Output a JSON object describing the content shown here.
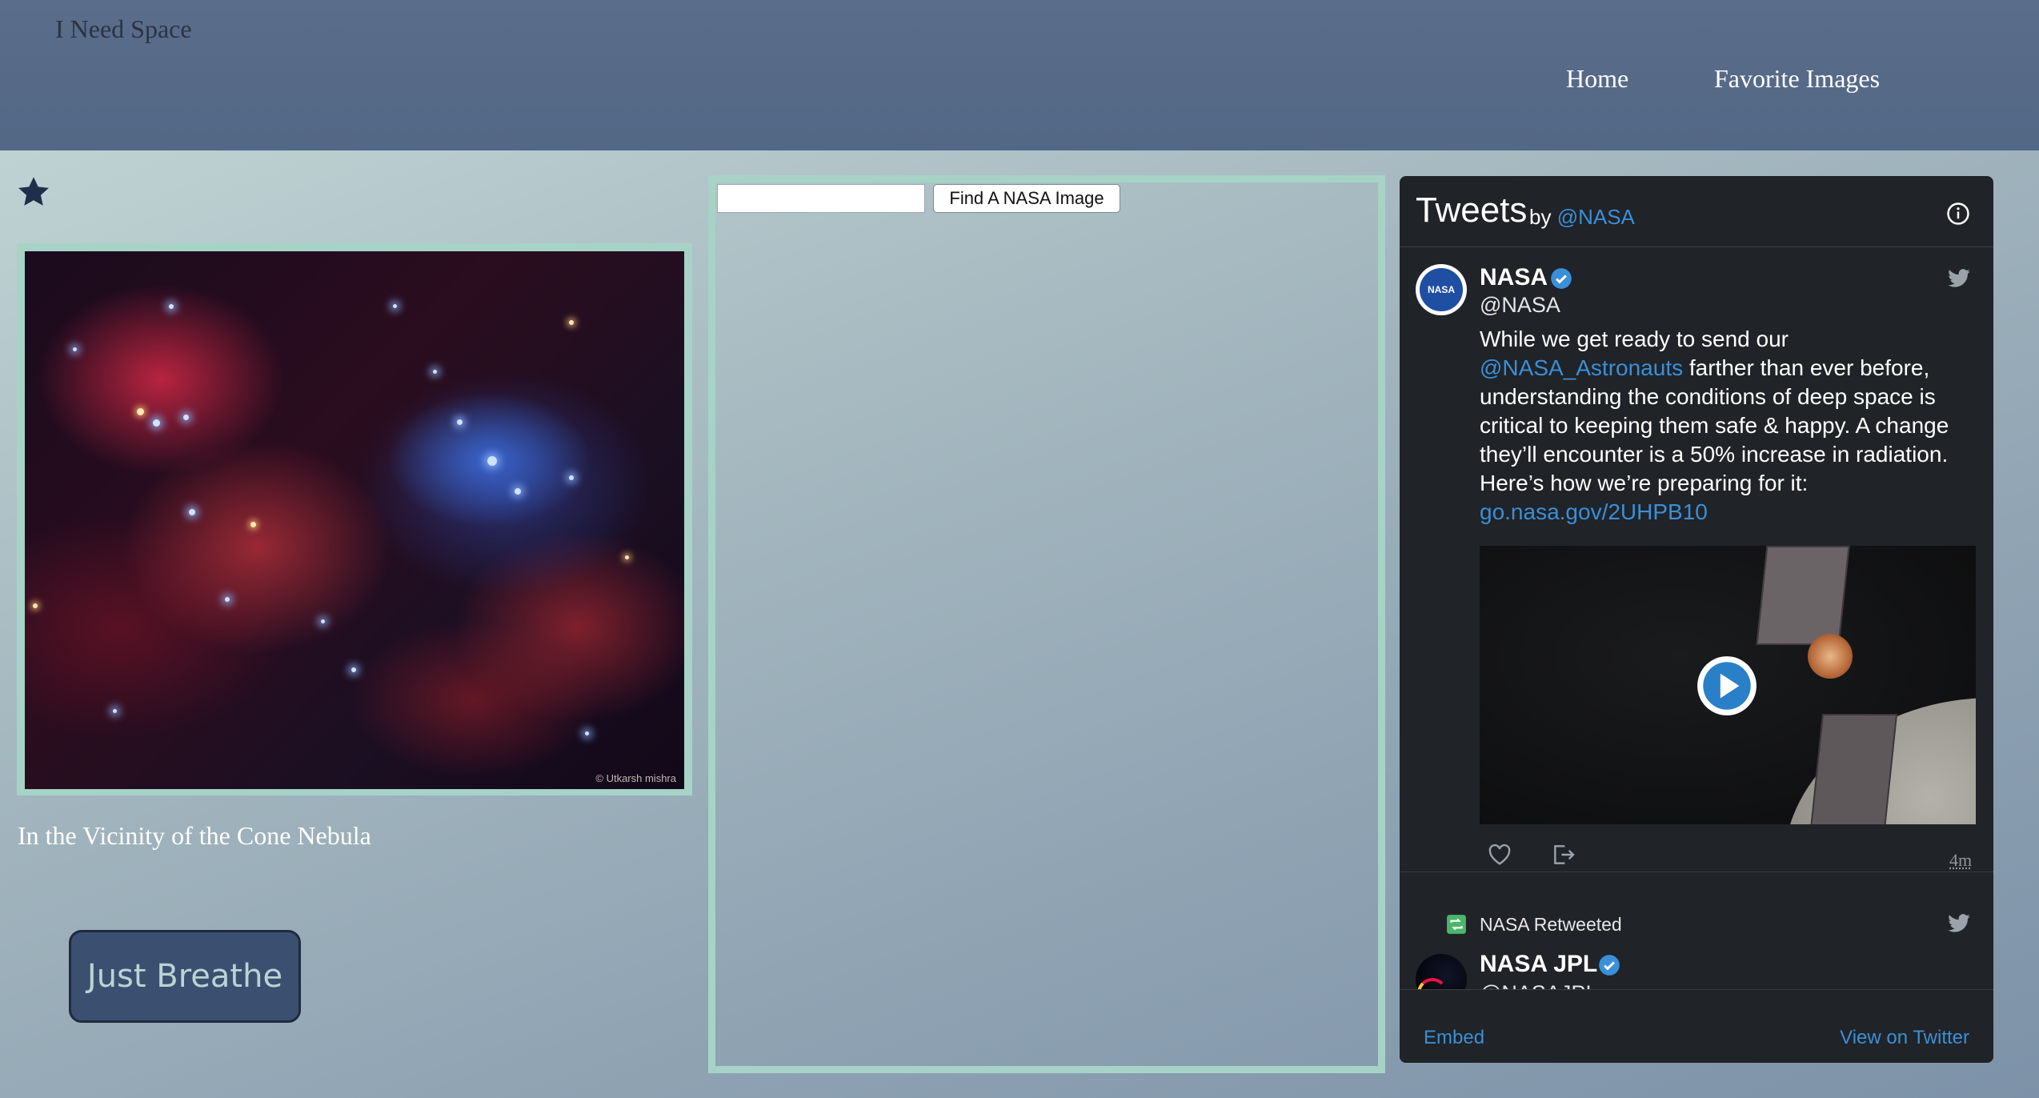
{
  "header": {
    "brand": "I Need Space",
    "nav": [
      {
        "label": "Home"
      },
      {
        "label": "Favorite Images"
      }
    ]
  },
  "apod": {
    "favorite_icon": "star-icon",
    "credit": "© Utkarsh mishra",
    "caption": "In the Vicinity of the Cone Nebula",
    "breathe_button": "Just Breathe"
  },
  "search": {
    "input_value": "",
    "placeholder": "",
    "button_label": "Find A NASA Image"
  },
  "twitter": {
    "title": "Tweets",
    "by": "by",
    "account": "@NASA",
    "tweet1": {
      "name": "NASA",
      "handle": "@NASA",
      "text_1": "While we get ready to send our",
      "mention": "@NASA_Astronauts",
      "text_2": " farther than ever before, understanding the conditions of deep space is critical to keeping them safe & happy. A change they’ll encounter is a 50% increase in radiation. Here’s how we’re preparing for it:",
      "link": "go.nasa.gov/2UHPB10",
      "time": "4m"
    },
    "retweet_label": "NASA Retweeted",
    "tweet2": {
      "name": "NASA JPL",
      "handle": "@NASAJPL"
    },
    "footer": {
      "embed": "Embed",
      "view": "View on Twitter"
    },
    "colors": {
      "link": "#3a8fd9",
      "background": "#202327",
      "retweet": "#4bb56a"
    }
  }
}
